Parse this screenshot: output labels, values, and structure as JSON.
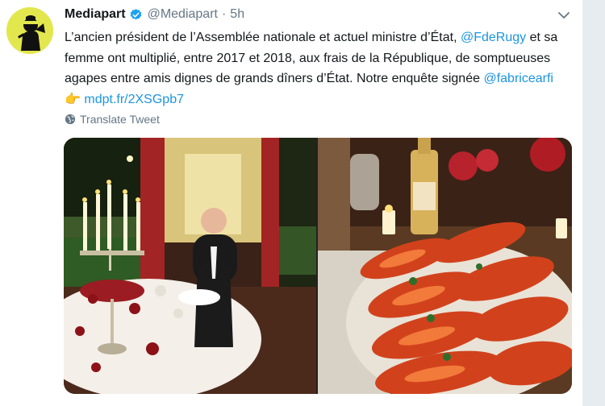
{
  "author": {
    "name": "Mediapart",
    "handle": "@Mediapart",
    "separator": "·",
    "time": "5h"
  },
  "tweet": {
    "text_1": "L’ancien président de l’Assemblée nationale et actuel ministre d’État, ",
    "mention_1": "@FdeRugy",
    "text_2": " et sa femme ont multiplié, entre 2017 et 2018, aux frais de la République, de somptueuses agapes entre amis dignes de grands dîners d’État. Notre enquête signée ",
    "mention_2": "@fabricearfi",
    "emoji": "👉",
    "link": "mdpt.fr/2XSGpb7"
  },
  "translate_label": "Translate Tweet",
  "icons": {
    "verified": "verified-badge-icon",
    "caret": "chevron-down-icon",
    "globe": "globe-icon"
  },
  "colors": {
    "link": "#1b95e0",
    "verified": "#1da1f2",
    "text": "#14171a",
    "secondary": "#657786",
    "avatar_bg": "#e3e74e"
  }
}
